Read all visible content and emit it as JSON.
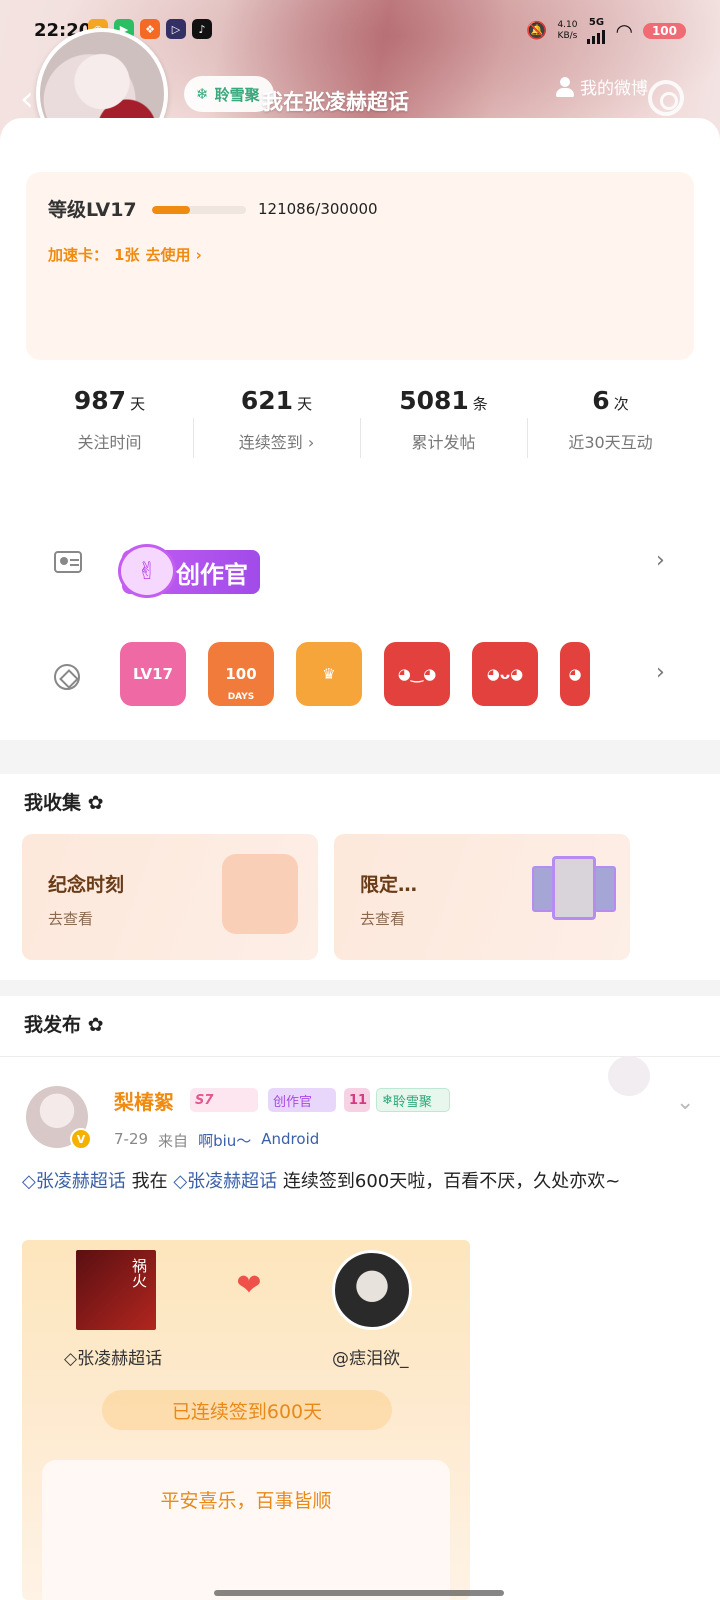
{
  "status_bar": {
    "time": "22:20",
    "network_speed": "4.10",
    "network_unit": "KB/s",
    "network_type": "5G",
    "battery": "100"
  },
  "header": {
    "title": "我在张凌赫超话",
    "topic_tag": "聆雪聚",
    "me_link": "我的微博"
  },
  "level": {
    "label": "等级LV17",
    "progress": 0.4036,
    "progress_text": "121086/300000",
    "speed_card_label": "加速卡：",
    "speed_card_count": "1张",
    "speed_card_action": "去使用 ›"
  },
  "stats": [
    {
      "value": "987",
      "unit": "天",
      "label": "关注时间"
    },
    {
      "value": "621",
      "unit": "天",
      "label": "连续签到 ›"
    },
    {
      "value": "5081",
      "unit": "条",
      "label": "累计发帖"
    },
    {
      "value": "6",
      "unit": "次",
      "label": "近30天互动"
    }
  ],
  "badges": {
    "creator_label": "创作官",
    "medals": [
      {
        "name": "lv17-medal",
        "text": "LV17",
        "color": "#ef6aa4"
      },
      {
        "name": "100-days-medal",
        "text": "100",
        "color": "#f07b3a"
      },
      {
        "name": "crown-medal",
        "text": "♛",
        "color": "#f6a53a"
      },
      {
        "name": "dragon-medal-1",
        "text": "◕‿◕",
        "color": "#e2413d"
      },
      {
        "name": "dragon-medal-2",
        "text": "◕ᴗ◕",
        "color": "#e2413d"
      },
      {
        "name": "dragon-medal-3",
        "text": "◕",
        "color": "#e2413d"
      }
    ],
    "medal_sub": "DAYS"
  },
  "collection": {
    "title": "我收集",
    "cards": [
      {
        "name": "纪念时刻",
        "action": "去查看"
      },
      {
        "name": "限定…",
        "action": "去查看"
      }
    ]
  },
  "posts_section": {
    "title": "我发布"
  },
  "post": {
    "author": "梨椿絮",
    "tags": [
      "S7",
      "创作官",
      "11",
      "聆雪聚"
    ],
    "date": "7-29",
    "from_label": "来自",
    "source": "啊biu～",
    "device": "Android",
    "topic1": "张凌赫超话",
    "text_mid": " 我在",
    "topic2": "张凌赫超话",
    "text_end": " 连续签到600天啦，百看不厌，久处亦欢~",
    "card": {
      "left_label": "张凌赫超话",
      "right_label": "@痣泪欲_",
      "streak_text": "已连续签到600天",
      "wish_text": "平安喜乐，百事皆顺",
      "poster_text": "祸火"
    }
  }
}
